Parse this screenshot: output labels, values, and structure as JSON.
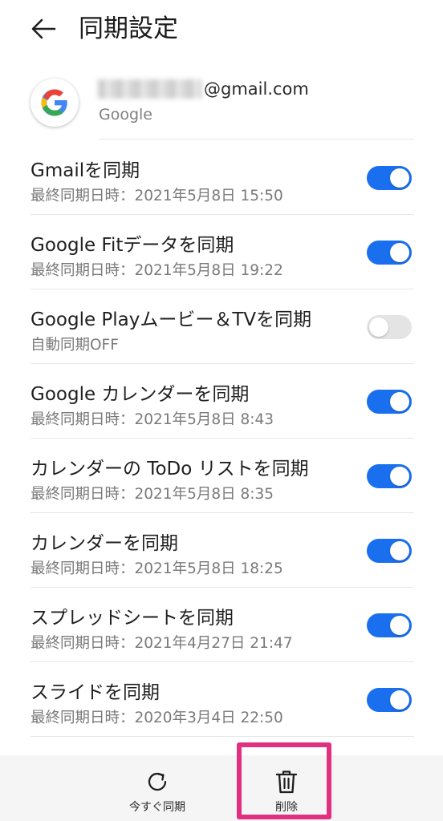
{
  "header": {
    "title": "同期設定"
  },
  "account": {
    "email_suffix": "@gmail.com",
    "type": "Google"
  },
  "sync_items": [
    {
      "title": "Gmailを同期",
      "subtitle": "最終同期日時：2021年5月8日 15:50",
      "enabled": true
    },
    {
      "title": "Google Fitデータを同期",
      "subtitle": "最終同期日時：2021年5月8日 19:22",
      "enabled": true
    },
    {
      "title": "Google Playムービー＆TVを同期",
      "subtitle": "自動同期OFF",
      "enabled": false
    },
    {
      "title": "Google カレンダーを同期",
      "subtitle": "最終同期日時：2021年5月8日 8:43",
      "enabled": true
    },
    {
      "title": "カレンダーの ToDo リストを同期",
      "subtitle": "最終同期日時：2021年5月8日 8:35",
      "enabled": true
    },
    {
      "title": "カレンダーを同期",
      "subtitle": "最終同期日時：2021年5月8日 18:25",
      "enabled": true
    },
    {
      "title": "スプレッドシートを同期",
      "subtitle": "最終同期日時：2021年4月27日 21:47",
      "enabled": true
    },
    {
      "title": "スライドを同期",
      "subtitle": "最終同期日時：2020年3月4日 22:50",
      "enabled": true
    }
  ],
  "bottom_bar": {
    "sync_now_label": "今すぐ同期",
    "delete_label": "削除"
  },
  "colors": {
    "toggle_on": "#1a6fee",
    "toggle_off": "#e4e4e4",
    "highlight": "#e0307f"
  }
}
